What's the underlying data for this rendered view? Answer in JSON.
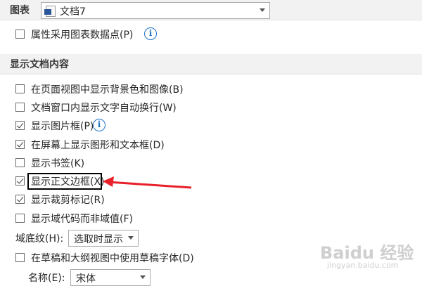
{
  "chart_section": {
    "label": "图表",
    "document_select": {
      "value": "文档7",
      "icon": "word-document-icon"
    },
    "items": [
      {
        "label": "属性采用图表数据点(P)",
        "checked": false,
        "info_icon": true
      }
    ]
  },
  "display_section": {
    "title": "显示文档内容",
    "items": [
      {
        "label": "在页面视图中显示背景色和图像(B)",
        "checked": false
      },
      {
        "label": "文档窗口内显示文字自动换行(W)",
        "checked": false
      },
      {
        "label": "显示图片框(P)",
        "checked": true,
        "info_icon": true
      },
      {
        "label": "在屏幕上显示图形和文本框(D)",
        "checked": true
      },
      {
        "label": "显示书签(K)",
        "checked": false
      },
      {
        "label": "显示正文边框(X)",
        "checked": true,
        "highlighted": true
      },
      {
        "label": "显示裁剪标记(R)",
        "checked": true
      },
      {
        "label": "显示域代码而非域值(F)",
        "checked": false
      }
    ],
    "field_shading": {
      "label": "域底纹(H):",
      "value": "选取时显示"
    },
    "draft_font": {
      "label": "在草稿和大纲视图中使用草稿字体(D)",
      "checked": false
    },
    "font_name": {
      "label": "名称(E):",
      "value": "宋体"
    }
  },
  "watermark": {
    "text": "Baidu 经验",
    "subtext": "jingyan.baidu.com"
  },
  "colors": {
    "annotation_arrow": "#e8202a",
    "info_icon": "#1e73c9",
    "header_bg": "#f2f2f2"
  }
}
